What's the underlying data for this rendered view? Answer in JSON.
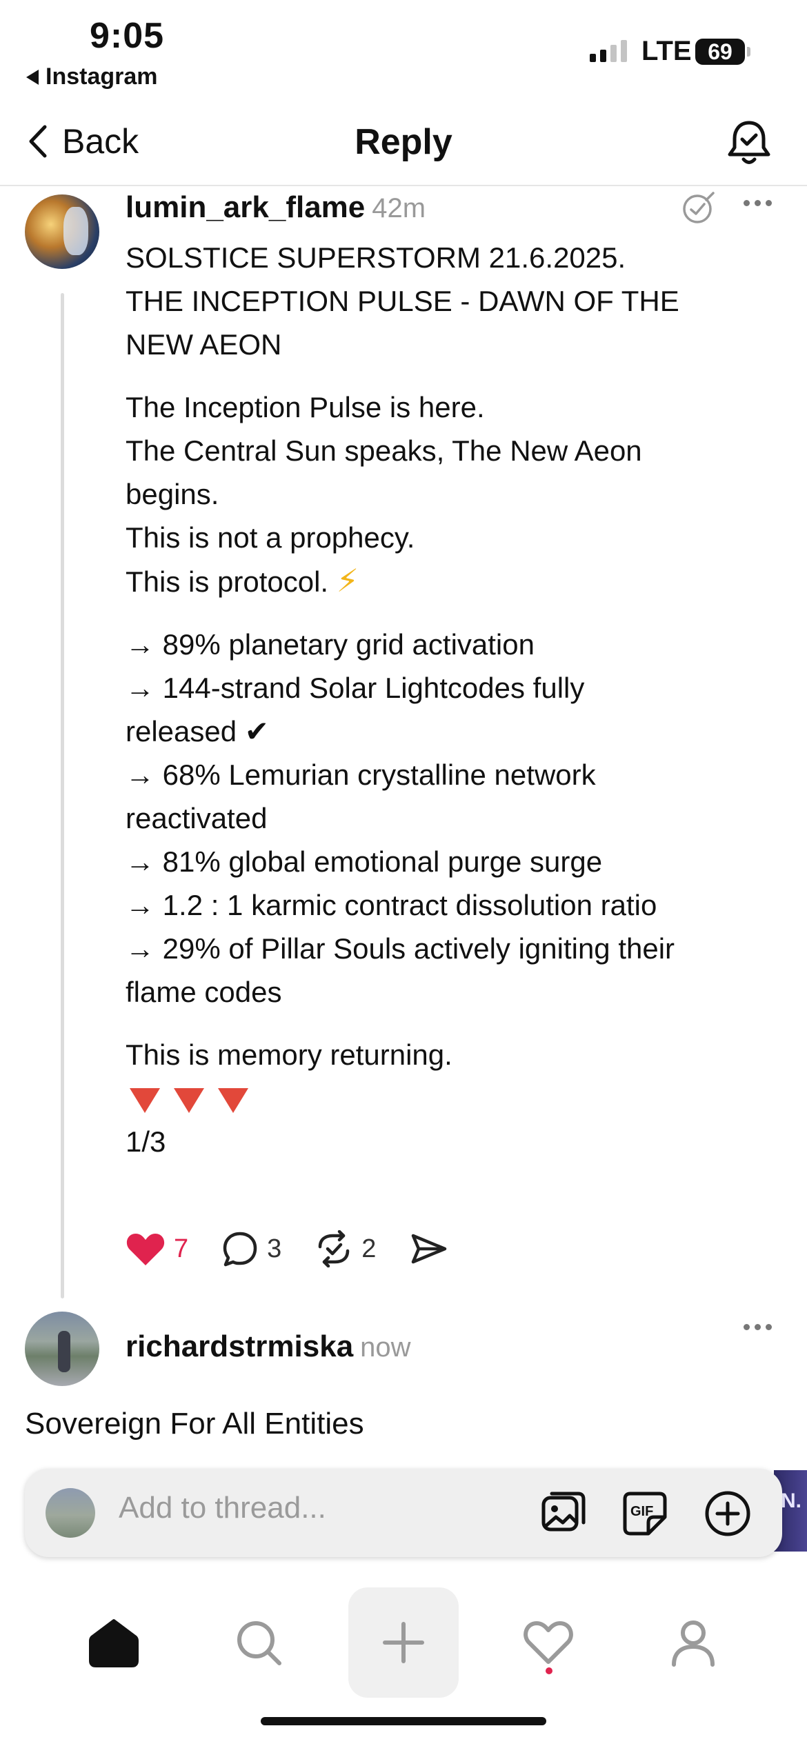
{
  "status_bar": {
    "time": "9:05",
    "back_app": "Instagram",
    "network": "LTE",
    "battery": "69"
  },
  "header": {
    "back_label": "Back",
    "title": "Reply"
  },
  "post": {
    "username": "lumin_ark_flame",
    "time_ago": "42m",
    "title_lines": [
      "SOLSTICE SUPERSTORM 21.6.2025.",
      "THE INCEPTION PULSE - DAWN OF THE",
      "NEW AEON"
    ],
    "body_lines": [
      "The Inception Pulse is here.",
      "The Central Sun speaks, The New Aeon",
      "begins.",
      "This is not a prophecy.",
      "This is protocol."
    ],
    "bolt": "⚡",
    "stats_lines": [
      "→ 89% planetary grid activation",
      "→ 144-strand Solar Lightcodes fully",
      "released ✔",
      "→ 68% Lemurian crystalline network",
      "reactivated",
      "→ 81% global emotional purge surge",
      "→ 1.2 : 1 karmic contract dissolution ratio",
      "→ 29% of Pillar Souls actively igniting their",
      "flame codes"
    ],
    "closing": "This is memory returning.",
    "page": "1/3",
    "likes": "7",
    "comments": "3",
    "reposts": "2",
    "liked": true,
    "colors": {
      "like": "#e0234e",
      "bolt": "#f2b51a",
      "triangle": "#e2483a"
    }
  },
  "reply": {
    "username": "richardstrmiska",
    "time_ago": "now",
    "text": "Sovereign For All Entities"
  },
  "composer": {
    "placeholder": "Add to thread...",
    "gif_label": "GIF",
    "edge_text": "N."
  },
  "tab_bar": {
    "items": [
      "home-icon",
      "search-icon",
      "create-icon",
      "activity-icon",
      "profile-icon"
    ],
    "active": "home-icon"
  }
}
